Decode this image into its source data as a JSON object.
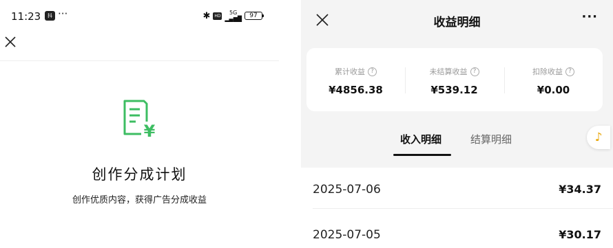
{
  "left_screen": {
    "status_bar": {
      "time": "11:23",
      "app_badge": "抖音",
      "more": "···",
      "signal_label": "5G",
      "battery": "97"
    },
    "plan": {
      "title": "创作分成计划",
      "description": "创作优质内容，获得广告分成收益"
    },
    "icon_color": "#3dbd62"
  },
  "right_screen": {
    "nav": {
      "title": "收益明细",
      "more": "···"
    },
    "summary": [
      {
        "label": "累计收益",
        "value": "¥4856.38"
      },
      {
        "label": "未结算收益",
        "value": "¥539.12"
      },
      {
        "label": "扣除收益",
        "value": "¥0.00"
      }
    ],
    "help_glyph": "?",
    "tabs": {
      "income": "收入明细",
      "settlement": "结算明细",
      "active": "income"
    },
    "music_icon": "♪",
    "records": [
      {
        "date": "2025-07-06",
        "amount": "¥34.37"
      },
      {
        "date": "2025-07-05",
        "amount": "¥30.17"
      }
    ]
  }
}
